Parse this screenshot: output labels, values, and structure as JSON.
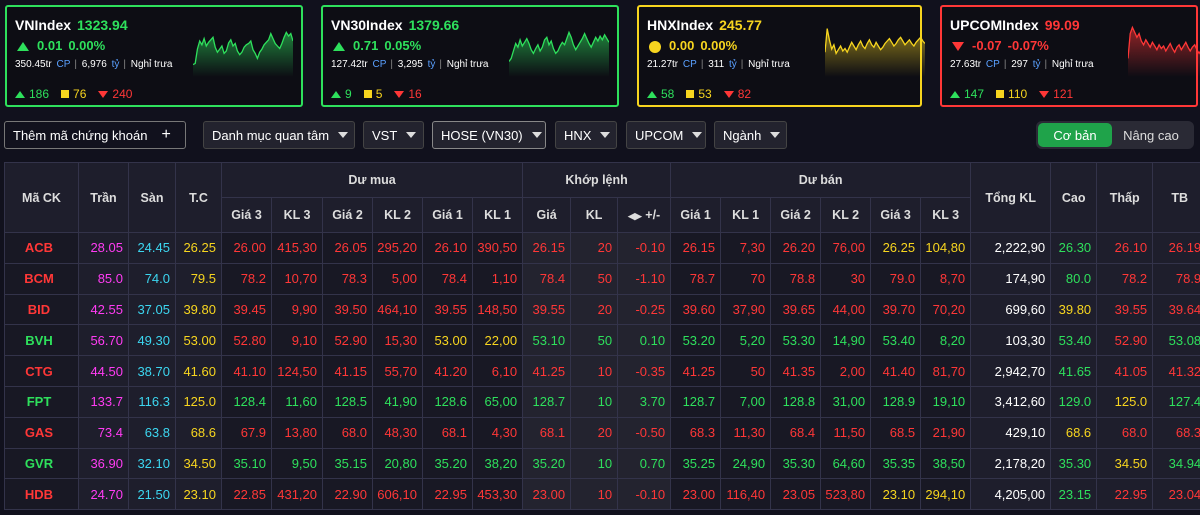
{
  "colors": {
    "up": "#2ee05c",
    "down": "#ff3737",
    "ref": "#f7d51f",
    "ceil": "#ff3cf3",
    "floor": "#3cd6f0"
  },
  "indices": [
    {
      "name": "VNIndex",
      "value": "1323.94",
      "change": "0.01",
      "pct": "0.00%",
      "icon": "up-triangle-icon",
      "dir": "up",
      "vol": "350.45tr",
      "vol_unit": "CP",
      "val": "6,976",
      "val_unit": "tỷ",
      "status": "Nghỉ trưa",
      "adv": "186",
      "ref": "76",
      "dec": "240",
      "spark": [
        0.8,
        0.78,
        0.55,
        0.42,
        0.48,
        0.38,
        0.5,
        0.44,
        0.4,
        0.36,
        0.52,
        0.6,
        0.55,
        0.5,
        0.62,
        0.58,
        0.45,
        0.4,
        0.5,
        0.46,
        0.58,
        0.64,
        0.6,
        0.52,
        0.48,
        0.46,
        0.42,
        0.56,
        0.62,
        0.7,
        0.6,
        0.55,
        0.48,
        0.44,
        0.4,
        0.3,
        0.38,
        0.46,
        0.5,
        0.54,
        0.46,
        0.36,
        0.28,
        0.34,
        0.3,
        0.42
      ]
    },
    {
      "name": "VN30Index",
      "value": "1379.66",
      "change": "0.71",
      "pct": "0.05%",
      "icon": "up-triangle-icon",
      "dir": "up",
      "vol": "127.42tr",
      "vol_unit": "CP",
      "val": "3,295",
      "val_unit": "tỷ",
      "status": "Nghỉ trưa",
      "adv": "9",
      "ref": "5",
      "dec": "16",
      "spark": [
        0.75,
        0.7,
        0.58,
        0.46,
        0.52,
        0.4,
        0.5,
        0.44,
        0.38,
        0.46,
        0.56,
        0.62,
        0.54,
        0.48,
        0.58,
        0.52,
        0.4,
        0.36,
        0.48,
        0.42,
        0.54,
        0.62,
        0.58,
        0.5,
        0.44,
        0.48,
        0.38,
        0.28,
        0.36,
        0.48,
        0.56,
        0.5,
        0.44,
        0.38,
        0.3,
        0.38,
        0.46,
        0.52,
        0.44,
        0.36,
        0.42,
        0.34,
        0.4,
        0.32,
        0.38,
        0.44
      ]
    },
    {
      "name": "HNXIndex",
      "value": "245.77",
      "change": "0.00",
      "pct": "0.00%",
      "icon": "dot-icon",
      "dir": "ref",
      "vol": "21.27tr",
      "vol_unit": "CP",
      "val": "311",
      "val_unit": "tỷ",
      "status": "Nghỉ trưa",
      "adv": "58",
      "ref": "53",
      "dec": "82",
      "spark": [
        0.6,
        0.22,
        0.4,
        0.55,
        0.48,
        0.62,
        0.56,
        0.5,
        0.58,
        0.54,
        0.6,
        0.52,
        0.44,
        0.5,
        0.56,
        0.48,
        0.42,
        0.5,
        0.54,
        0.46,
        0.4,
        0.48,
        0.52,
        0.44,
        0.5,
        0.56,
        0.52,
        0.46,
        0.42,
        0.38,
        0.44,
        0.5,
        0.46,
        0.4,
        0.36,
        0.42,
        0.48,
        0.44,
        0.4,
        0.46,
        0.5,
        0.44,
        0.4,
        0.36,
        0.42,
        0.46
      ]
    },
    {
      "name": "UPCOMIndex",
      "value": "99.09",
      "change": "-0.07",
      "pct": "-0.07%",
      "icon": "down-triangle-icon",
      "dir": "down",
      "vol": "27.63tr",
      "vol_unit": "CP",
      "val": "297",
      "val_unit": "tỷ",
      "status": "Nghỉ trưa",
      "adv": "147",
      "ref": "110",
      "dec": "121",
      "spark": [
        0.7,
        0.3,
        0.2,
        0.28,
        0.36,
        0.3,
        0.42,
        0.48,
        0.4,
        0.46,
        0.52,
        0.44,
        0.5,
        0.56,
        0.48,
        0.54,
        0.5,
        0.58,
        0.52,
        0.46,
        0.54,
        0.6,
        0.52,
        0.48,
        0.56,
        0.5,
        0.44,
        0.52,
        0.58,
        0.52,
        0.48,
        0.56,
        0.62,
        0.56,
        0.5,
        0.58,
        0.52,
        0.48,
        0.56,
        0.62,
        0.58,
        0.52,
        0.6,
        0.56,
        0.62,
        0.66
      ]
    }
  ],
  "toolbar": {
    "add_label": "Thêm mã chứng khoán",
    "add_plus": "+",
    "watchlist": "Danh mục quan tâm",
    "vst": "VST",
    "hose": "HOSE (VN30)",
    "hnx": "HNX",
    "upcom": "UPCOM",
    "industry": "Ngành",
    "basic": "Cơ bản",
    "advanced": "Nâng cao"
  },
  "headers": {
    "sym": "Mã CK",
    "ceil": "Trần",
    "floor": "Sàn",
    "ref": "T.C",
    "bid_group": "Dư mua",
    "match_group": "Khớp lệnh",
    "ask_group": "Dư bán",
    "total": "Tổng KL",
    "high": "Cao",
    "low": "Thấp",
    "avg": "TB",
    "p3": "Giá 3",
    "v3": "KL 3",
    "p2": "Giá 2",
    "v2": "KL 2",
    "p1": "Giá 1",
    "v1": "KL 1",
    "price": "Giá",
    "vol": "KL",
    "chg": "+/-"
  },
  "rows": [
    {
      "sym": "ACB",
      "color": "dn",
      "ceil": "28.05",
      "floor": "24.45",
      "ref": "26.25",
      "b3": "26.00",
      "bv3": "415,30",
      "b2": "26.05",
      "bv2": "295,20",
      "b1": "26.10",
      "bv1": "390,50",
      "mp": "26.15",
      "mv": "20",
      "mc": "-0.10",
      "a1": "26.15",
      "av1": "7,30",
      "a2": "26.20",
      "av2": "76,00",
      "a3": "26.25",
      "av3": "104,80",
      "tot": "2,222,90",
      "hi": "26.30",
      "lo": "26.10",
      "avg": "26.19",
      "c_b3": "dn",
      "c_b2": "dn",
      "c_b1": "dn",
      "c_mp": "dn",
      "c_a1": "dn",
      "c_a2": "dn",
      "c_a3": "rf",
      "c_hi": "up",
      "c_lo": "dn",
      "c_avg": "dn"
    },
    {
      "sym": "BCM",
      "color": "dn",
      "ceil": "85.0",
      "floor": "74.0",
      "ref": "79.5",
      "b3": "78.2",
      "bv3": "10,70",
      "b2": "78.3",
      "bv2": "5,00",
      "b1": "78.4",
      "bv1": "1,10",
      "mp": "78.4",
      "mv": "50",
      "mc": "-1.10",
      "a1": "78.7",
      "av1": "70",
      "a2": "78.8",
      "av2": "30",
      "a3": "79.0",
      "av3": "8,70",
      "tot": "174,90",
      "hi": "80.0",
      "lo": "78.2",
      "avg": "78.9",
      "c_b3": "dn",
      "c_b2": "dn",
      "c_b1": "dn",
      "c_mp": "dn",
      "c_a1": "dn",
      "c_a2": "dn",
      "c_a3": "dn",
      "c_hi": "up",
      "c_lo": "dn",
      "c_avg": "dn"
    },
    {
      "sym": "BID",
      "color": "dn",
      "ceil": "42.55",
      "floor": "37.05",
      "ref": "39.80",
      "b3": "39.45",
      "bv3": "9,90",
      "b2": "39.50",
      "bv2": "464,10",
      "b1": "39.55",
      "bv1": "148,50",
      "mp": "39.55",
      "mv": "20",
      "mc": "-0.25",
      "a1": "39.60",
      "av1": "37,90",
      "a2": "39.65",
      "av2": "44,00",
      "a3": "39.70",
      "av3": "70,20",
      "tot": "699,60",
      "hi": "39.80",
      "lo": "39.55",
      "avg": "39.64",
      "c_b3": "dn",
      "c_b2": "dn",
      "c_b1": "dn",
      "c_mp": "dn",
      "c_a1": "dn",
      "c_a2": "dn",
      "c_a3": "dn",
      "c_hi": "rf",
      "c_lo": "dn",
      "c_avg": "dn"
    },
    {
      "sym": "BVH",
      "color": "up",
      "ceil": "56.70",
      "floor": "49.30",
      "ref": "53.00",
      "b3": "52.80",
      "bv3": "9,10",
      "b2": "52.90",
      "bv2": "15,30",
      "b1": "53.00",
      "bv1": "22,00",
      "mp": "53.10",
      "mv": "50",
      "mc": "0.10",
      "a1": "53.20",
      "av1": "5,20",
      "a2": "53.30",
      "av2": "14,90",
      "a3": "53.40",
      "av3": "8,20",
      "tot": "103,30",
      "hi": "53.40",
      "lo": "52.90",
      "avg": "53.08",
      "c_b3": "dn",
      "c_b2": "dn",
      "c_b1": "rf",
      "c_mp": "up",
      "c_a1": "up",
      "c_a2": "up",
      "c_a3": "up",
      "c_hi": "up",
      "c_lo": "dn",
      "c_avg": "up"
    },
    {
      "sym": "CTG",
      "color": "dn",
      "ceil": "44.50",
      "floor": "38.70",
      "ref": "41.60",
      "b3": "41.10",
      "bv3": "124,50",
      "b2": "41.15",
      "bv2": "55,70",
      "b1": "41.20",
      "bv1": "6,10",
      "mp": "41.25",
      "mv": "10",
      "mc": "-0.35",
      "a1": "41.25",
      "av1": "50",
      "a2": "41.35",
      "av2": "2,00",
      "a3": "41.40",
      "av3": "81,70",
      "tot": "2,942,70",
      "hi": "41.65",
      "lo": "41.05",
      "avg": "41.32",
      "c_b3": "dn",
      "c_b2": "dn",
      "c_b1": "dn",
      "c_mp": "dn",
      "c_a1": "dn",
      "c_a2": "dn",
      "c_a3": "dn",
      "c_hi": "up",
      "c_lo": "dn",
      "c_avg": "dn"
    },
    {
      "sym": "FPT",
      "color": "up",
      "ceil": "133.7",
      "floor": "116.3",
      "ref": "125.0",
      "b3": "128.4",
      "bv3": "11,60",
      "b2": "128.5",
      "bv2": "41,90",
      "b1": "128.6",
      "bv1": "65,00",
      "mp": "128.7",
      "mv": "10",
      "mc": "3.70",
      "a1": "128.7",
      "av1": "7,00",
      "a2": "128.8",
      "av2": "31,00",
      "a3": "128.9",
      "av3": "19,10",
      "tot": "3,412,60",
      "hi": "129.0",
      "lo": "125.0",
      "avg": "127.4",
      "c_b3": "up",
      "c_b2": "up",
      "c_b1": "up",
      "c_mp": "up",
      "c_a1": "up",
      "c_a2": "up",
      "c_a3": "up",
      "c_hi": "up",
      "c_lo": "rf",
      "c_avg": "up"
    },
    {
      "sym": "GAS",
      "color": "dn",
      "ceil": "73.4",
      "floor": "63.8",
      "ref": "68.6",
      "b3": "67.9",
      "bv3": "13,80",
      "b2": "68.0",
      "bv2": "48,30",
      "b1": "68.1",
      "bv1": "4,30",
      "mp": "68.1",
      "mv": "20",
      "mc": "-0.50",
      "a1": "68.3",
      "av1": "11,30",
      "a2": "68.4",
      "av2": "11,50",
      "a3": "68.5",
      "av3": "21,90",
      "tot": "429,10",
      "hi": "68.6",
      "lo": "68.0",
      "avg": "68.3",
      "c_b3": "dn",
      "c_b2": "dn",
      "c_b1": "dn",
      "c_mp": "dn",
      "c_a1": "dn",
      "c_a2": "dn",
      "c_a3": "dn",
      "c_hi": "rf",
      "c_lo": "dn",
      "c_avg": "dn"
    },
    {
      "sym": "GVR",
      "color": "up",
      "ceil": "36.90",
      "floor": "32.10",
      "ref": "34.50",
      "b3": "35.10",
      "bv3": "9,50",
      "b2": "35.15",
      "bv2": "20,80",
      "b1": "35.20",
      "bv1": "38,20",
      "mp": "35.20",
      "mv": "10",
      "mc": "0.70",
      "a1": "35.25",
      "av1": "24,90",
      "a2": "35.30",
      "av2": "64,60",
      "a3": "35.35",
      "av3": "38,50",
      "tot": "2,178,20",
      "hi": "35.30",
      "lo": "34.50",
      "avg": "34.94",
      "c_b3": "up",
      "c_b2": "up",
      "c_b1": "up",
      "c_mp": "up",
      "c_a1": "up",
      "c_a2": "up",
      "c_a3": "up",
      "c_hi": "up",
      "c_lo": "rf",
      "c_avg": "up"
    },
    {
      "sym": "HDB",
      "color": "dn",
      "ceil": "24.70",
      "floor": "21.50",
      "ref": "23.10",
      "b3": "22.85",
      "bv3": "431,20",
      "b2": "22.90",
      "bv2": "606,10",
      "b1": "22.95",
      "bv1": "453,30",
      "mp": "23.00",
      "mv": "10",
      "mc": "-0.10",
      "a1": "23.00",
      "av1": "116,40",
      "a2": "23.05",
      "av2": "523,80",
      "a3": "23.10",
      "av3": "294,10",
      "tot": "4,205,00",
      "hi": "23.15",
      "lo": "22.95",
      "avg": "23.04",
      "c_b3": "dn",
      "c_b2": "dn",
      "c_b1": "dn",
      "c_mp": "dn",
      "c_a1": "dn",
      "c_a2": "dn",
      "c_a3": "rf",
      "c_hi": "up",
      "c_lo": "dn",
      "c_avg": "dn"
    }
  ]
}
